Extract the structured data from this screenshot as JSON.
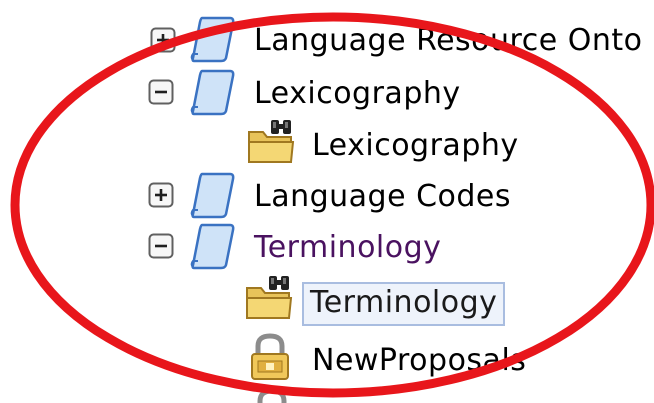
{
  "tree": {
    "items": [
      {
        "label": "Language Resource Onto",
        "state": "collapsed",
        "icon": "scroll-icon"
      },
      {
        "label": "Lexicography",
        "state": "expanded",
        "icon": "scroll-icon"
      },
      {
        "label": "Lexicography",
        "state": "leaf",
        "icon": "folder-binoculars-icon"
      },
      {
        "label": "Language Codes",
        "state": "collapsed",
        "icon": "scroll-icon"
      },
      {
        "label": "Terminology",
        "state": "expanded",
        "icon": "scroll-icon"
      },
      {
        "label": "Terminology",
        "state": "leaf-selected",
        "icon": "folder-binoculars-icon"
      },
      {
        "label": "NewProposals",
        "state": "leaf",
        "icon": "padlock-icon"
      }
    ]
  },
  "annotation": {
    "shape": "ellipse",
    "color": "#e8161b"
  },
  "colors": {
    "scroll_fill": "#cfe3f8",
    "scroll_stroke": "#3a72c2",
    "folder_fill": "#f4d774",
    "toggle_border": "#606060",
    "selection_bg": "#eef3fb",
    "selection_border": "#a9bde0"
  }
}
